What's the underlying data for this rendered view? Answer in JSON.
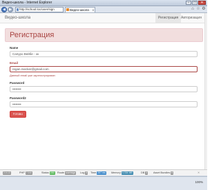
{
  "window": {
    "title": "Видео-школа - Internet Explorer",
    "controls": {
      "minimize": "–",
      "maximize": "□",
      "close": "✕"
    }
  },
  "browser": {
    "url": "http://school.loc/user/sign",
    "tab_title": "Видео-школа",
    "tab_close": "x"
  },
  "site": {
    "brand": "Видео-школа",
    "nav": {
      "register": "Регистрация",
      "login": "Авторизация"
    }
  },
  "page": {
    "title": "Регистрация"
  },
  "form": {
    "name_label": "Name",
    "name_value": "Сапуро Вейбе - ок",
    "email_label": "Email",
    "email_value": "regan.rsecker@gmail.com",
    "email_error": "Данный email уже зарегистрирован",
    "password_label": "Password",
    "password_value": "••••••••",
    "password2_label": "Password2",
    "password2_value": "••••••••",
    "submit_label": "Готово"
  },
  "debug": {
    "version": "2.0.13",
    "php_label": "PHP",
    "php_value": "7.0.6",
    "status_label": "Status",
    "status_value": "200",
    "route_label": "Route",
    "route_value": "user/sign",
    "log_label": "Log",
    "log_value": "5",
    "time_label": "Time",
    "time_value": "257 ms",
    "memory_label": "Memory",
    "memory_value": "4.334 MB",
    "db_label": "DB",
    "db_value": "3",
    "asset_label": "Asset Bundles",
    "asset_value": "6"
  },
  "statusbar": {
    "zoom": "100%"
  },
  "colors": {
    "danger": "#a94442",
    "danger_bg": "#f2dede",
    "button_red": "#d9534f",
    "success_green": "#5cb85c"
  }
}
